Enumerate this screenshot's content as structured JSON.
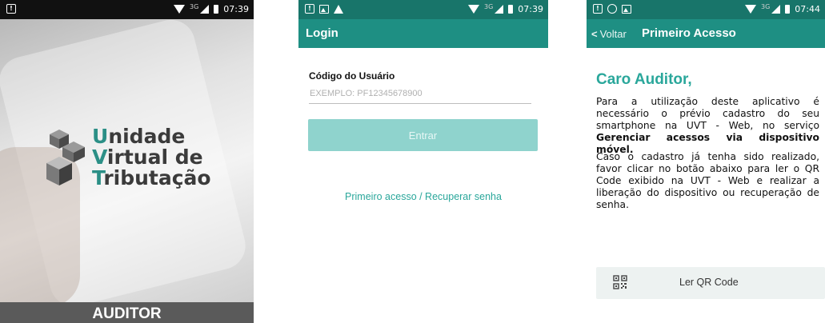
{
  "screens": [
    {
      "status": {
        "network": "3G",
        "time": "07:39"
      },
      "brand": {
        "line1_cap": "U",
        "line1_rest": "nidade",
        "line2_cap": "V",
        "line2_rest": "irtual de",
        "line3_cap": "T",
        "line3_rest": "ributação"
      },
      "footer": "AUDITOR",
      "icons": [
        "notification-icon",
        "wifi-icon",
        "signal-icon",
        "battery-icon",
        "logo-blocks-icon"
      ]
    },
    {
      "status": {
        "network": "3G",
        "time": "07:39"
      },
      "title": "Login",
      "field": {
        "label": "Código do Usuário",
        "placeholder": "EXEMPLO: PF12345678900",
        "value": ""
      },
      "button": "Entrar",
      "link": "Primeiro acesso / Recuperar senha",
      "colors": {
        "appbar": "#1e8f83",
        "button_disabled": "#8fd3cd",
        "link": "#2aa79b"
      }
    },
    {
      "status": {
        "network": "3G",
        "time": "07:44"
      },
      "back": "Voltar",
      "title": "Primeiro Acesso",
      "greeting": "Caro Auditor,",
      "para1": "Para a utilização deste aplicativo é necessário o prévio cadastro do seu smartphone na UVT - Web, no serviço",
      "para1_bold": "Gerenciar acessos via dispositivo móvel.",
      "para2": "Caso o cadastro já tenha sido realizado, favor clicar no botão abaixo para ler o QR Code exibido na UVT - Web e realizar a liberação do dispositivo ou recuperação de senha.",
      "qr_button": "Ler QR Code",
      "colors": {
        "accent": "#2aa79b"
      }
    }
  ]
}
